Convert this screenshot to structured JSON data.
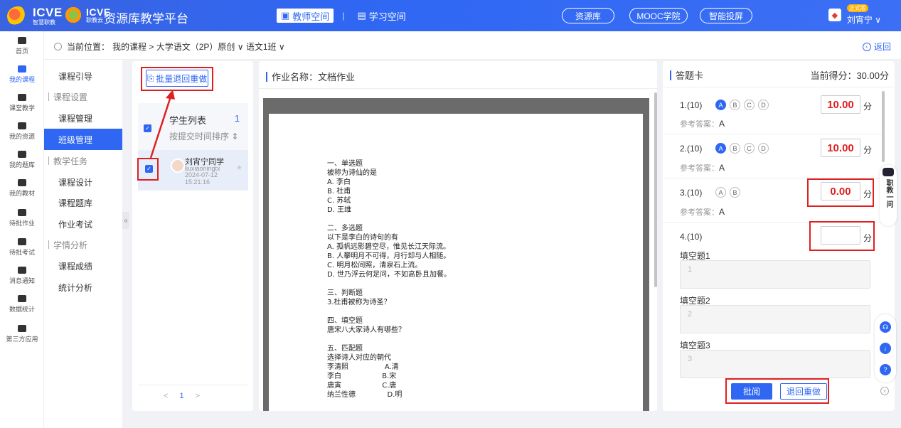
{
  "header": {
    "logo1_text": "ICVE",
    "logo1_sub": "智慧职教",
    "logo2_text": "ICVE",
    "logo2_sub": "职教云",
    "platform_title": "资源库教学平台",
    "tab_teacher": "教师空间",
    "tab_student": "学习空间",
    "pill_resource": "资源库",
    "pill_mooc": "MOOC学院",
    "pill_screen": "智能投屏",
    "user_badge": "正式版",
    "user_name": "刘宵宁 ∨",
    "brand_color": "#2f67f3"
  },
  "rail": {
    "home": "首页",
    "course": "我的课程",
    "classroom": "课堂教学",
    "resource": "我的资源",
    "bank": "我的题库",
    "material": "我的教材",
    "pending_homework": "待批作业",
    "pending_exam": "待批考试",
    "message": "消息通知",
    "stats": "数据统计",
    "third": "第三方应用"
  },
  "breadcrumb": {
    "prefix": "当前位置：",
    "path": "我的课程 > 大学语文（2P）原创 ∨ 语文1班 ∨",
    "back": "返回"
  },
  "menu": {
    "guide": "课程引导",
    "section_settings": "课程设置",
    "course_manage": "课程管理",
    "class_manage": "班级管理",
    "section_tasks": "教学任务",
    "course_design": "课程设计",
    "course_bank": "课程题库",
    "homework_exam": "作业考试",
    "section_analysis": "学情分析",
    "course_grades": "课程成绩",
    "stats_analysis": "统计分析"
  },
  "students": {
    "batch_button": "批量退回重做",
    "list_title": "学生列表",
    "count": "1",
    "sort": "按提交时间排序 ⇕",
    "student_name": "刘宵宁同学",
    "student_id": "liuxiaoningtx",
    "submit_time": "2024-07-12 15:21:16",
    "page": "1",
    "prev": "<",
    "next": ">"
  },
  "document": {
    "title": "作业名称：文档作业",
    "body": "一、单选题\n被称为诗仙的是\nA. 李白\nB. 杜甫\nC. 苏轼\nD. 王维\n\n二、多选题\n以下是李白的诗句的有\nA. 孤帆远影碧空尽，惟见长江天际流。\nB. 人攀明月不可得，月行却与人相随。\nC. 明月松间照，清泉石上流。\nD. 世乃浮云何足问，不如高卧且加餐。\n\n三、判断题\n3.杜甫被称为诗圣？\n\n四、填空题\n唐宋八大家诗人有哪些？\n\n五、匹配题\n选择诗人对应的朝代\n李清照                A.清\n李白                  B.宋\n唐寅                  C.唐\n纳兰性德              D.明"
  },
  "answer_card": {
    "title": "答题卡",
    "current_score": "当前得分：30.00分",
    "unit": "分",
    "ref_prefix": "参考答案：",
    "q1": {
      "label": "1.(10)",
      "score": "10.00",
      "answer": "A",
      "options": [
        "A",
        "B",
        "C",
        "D"
      ]
    },
    "q2": {
      "label": "2.(10)",
      "score": "10.00",
      "answer": "A",
      "options": [
        "A",
        "B",
        "C",
        "D"
      ]
    },
    "q3": {
      "label": "3.(10)",
      "score": "0.00",
      "answer": "A",
      "options": [
        "A",
        "B"
      ]
    },
    "q4": {
      "label": "4.(10)",
      "score": ""
    },
    "blank1": {
      "label": "填空题1",
      "placeholder": "1"
    },
    "blank2": {
      "label": "填空题2",
      "placeholder": "2"
    },
    "blank3": {
      "label": "填空题3",
      "placeholder": "3"
    },
    "review_button": "批阅",
    "return_button": "退回重做"
  },
  "helper": {
    "text": "职教一问"
  },
  "colors": {
    "highlight": "#e02020",
    "accent": "#2f67f3"
  }
}
